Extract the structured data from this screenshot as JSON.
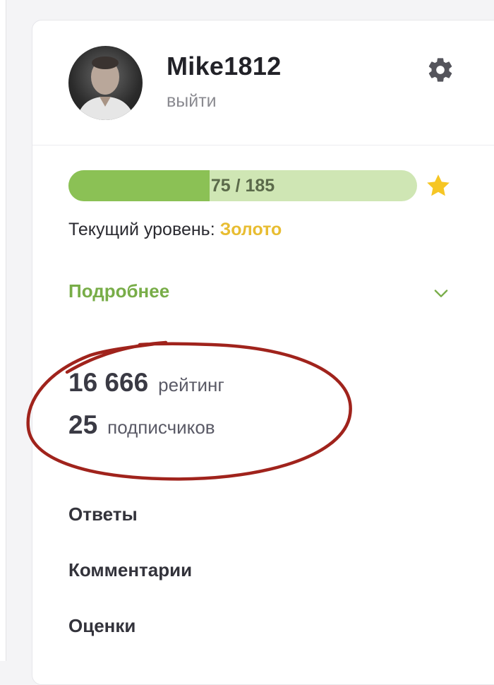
{
  "profile": {
    "username": "Mike1812",
    "logout_label": "выйти",
    "avatar_icon": "user-photo",
    "settings_icon": "gear-icon"
  },
  "progress": {
    "text": "75 / 185",
    "current": 75,
    "max": 185,
    "fill_color": "#8bc155",
    "track_color": "#cfe6b4",
    "star_icon": "star-icon",
    "star_color": "#f6c624"
  },
  "level": {
    "label": "Текущий уровень:",
    "value": "Золото",
    "value_color": "#e8bd32"
  },
  "details": {
    "label": "Подробнее",
    "icon": "chevron-down-icon",
    "color": "#78ad48"
  },
  "stats": {
    "rating_value": "16 666",
    "rating_label": "рейтинг",
    "subscribers_value": "25",
    "subscribers_label": "подписчиков"
  },
  "menu": {
    "items": [
      {
        "label": "Ответы"
      },
      {
        "label": "Комментарии"
      },
      {
        "label": "Оценки"
      }
    ]
  },
  "annotation": {
    "shape": "hand-drawn-ellipse",
    "color": "#a0231c"
  }
}
